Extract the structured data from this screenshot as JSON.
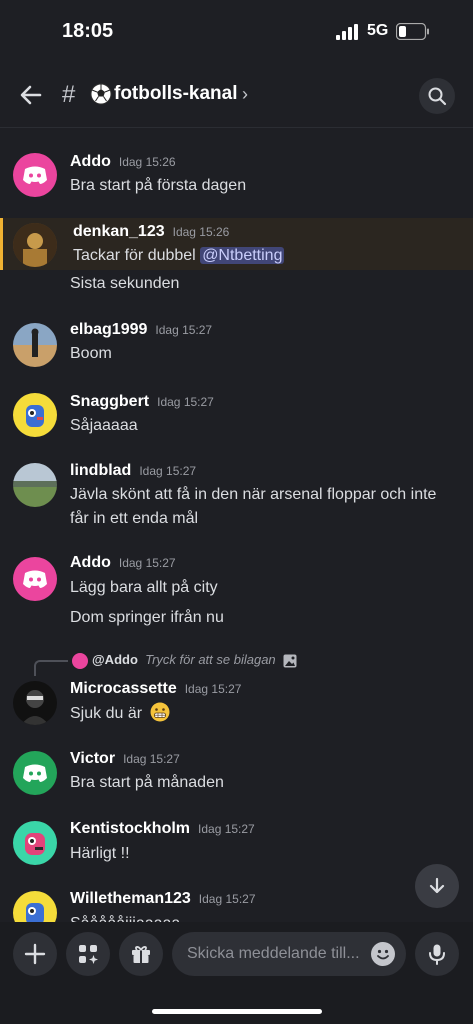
{
  "status": {
    "time": "18:05",
    "network": "5G"
  },
  "header": {
    "channel": "fotbolls-kanal",
    "hash": "#",
    "chevron": "›"
  },
  "messages": [
    {
      "user": "Addo",
      "time": "Idag 15:26",
      "lines": [
        "Bra start på första dagen"
      ]
    },
    {
      "user": "denkan_123",
      "time": "Idag 15:26",
      "lines": [
        "Tackar för dubbel",
        "Sista sekunden"
      ],
      "mention": "@Ntbetting"
    },
    {
      "user": "elbag1999",
      "time": "Idag 15:27",
      "lines": [
        "Boom"
      ]
    },
    {
      "user": "Snaggbert",
      "time": "Idag 15:27",
      "lines": [
        "Såjaaaaa"
      ]
    },
    {
      "user": "lindblad",
      "time": "Idag 15:27",
      "lines": [
        "Jävla skönt att få in den när arsenal floppar och inte",
        "får in ett enda mål"
      ]
    },
    {
      "user": "Addo",
      "time": "Idag 15:27",
      "lines": [
        "Lägg bara allt på city",
        "Dom springer ifrån nu"
      ]
    },
    {
      "user": "Microcassette",
      "time": "Idag 15:27",
      "lines": [
        "Sjuk du är"
      ],
      "reply": {
        "to": "@Addo",
        "text": "Tryck för att se bilagan"
      }
    },
    {
      "user": "Victor",
      "time": "Idag 15:27",
      "lines": [
        "Bra start på månaden"
      ]
    },
    {
      "user": "Kentistockholm",
      "time": "Idag 15:27",
      "lines": [
        "Härligt  !!"
      ]
    },
    {
      "user": "Willetheman123",
      "time": "Idag 15:27",
      "lines": [
        "Såååååjjjaaaaa"
      ]
    }
  ],
  "composer": {
    "placeholder": "Skicka meddelande till..."
  },
  "colors": {
    "accent": "#5865f2",
    "discord_pink": "#eb459e",
    "discord_green": "#23a55a",
    "highlight_bar": "#f0b232"
  }
}
